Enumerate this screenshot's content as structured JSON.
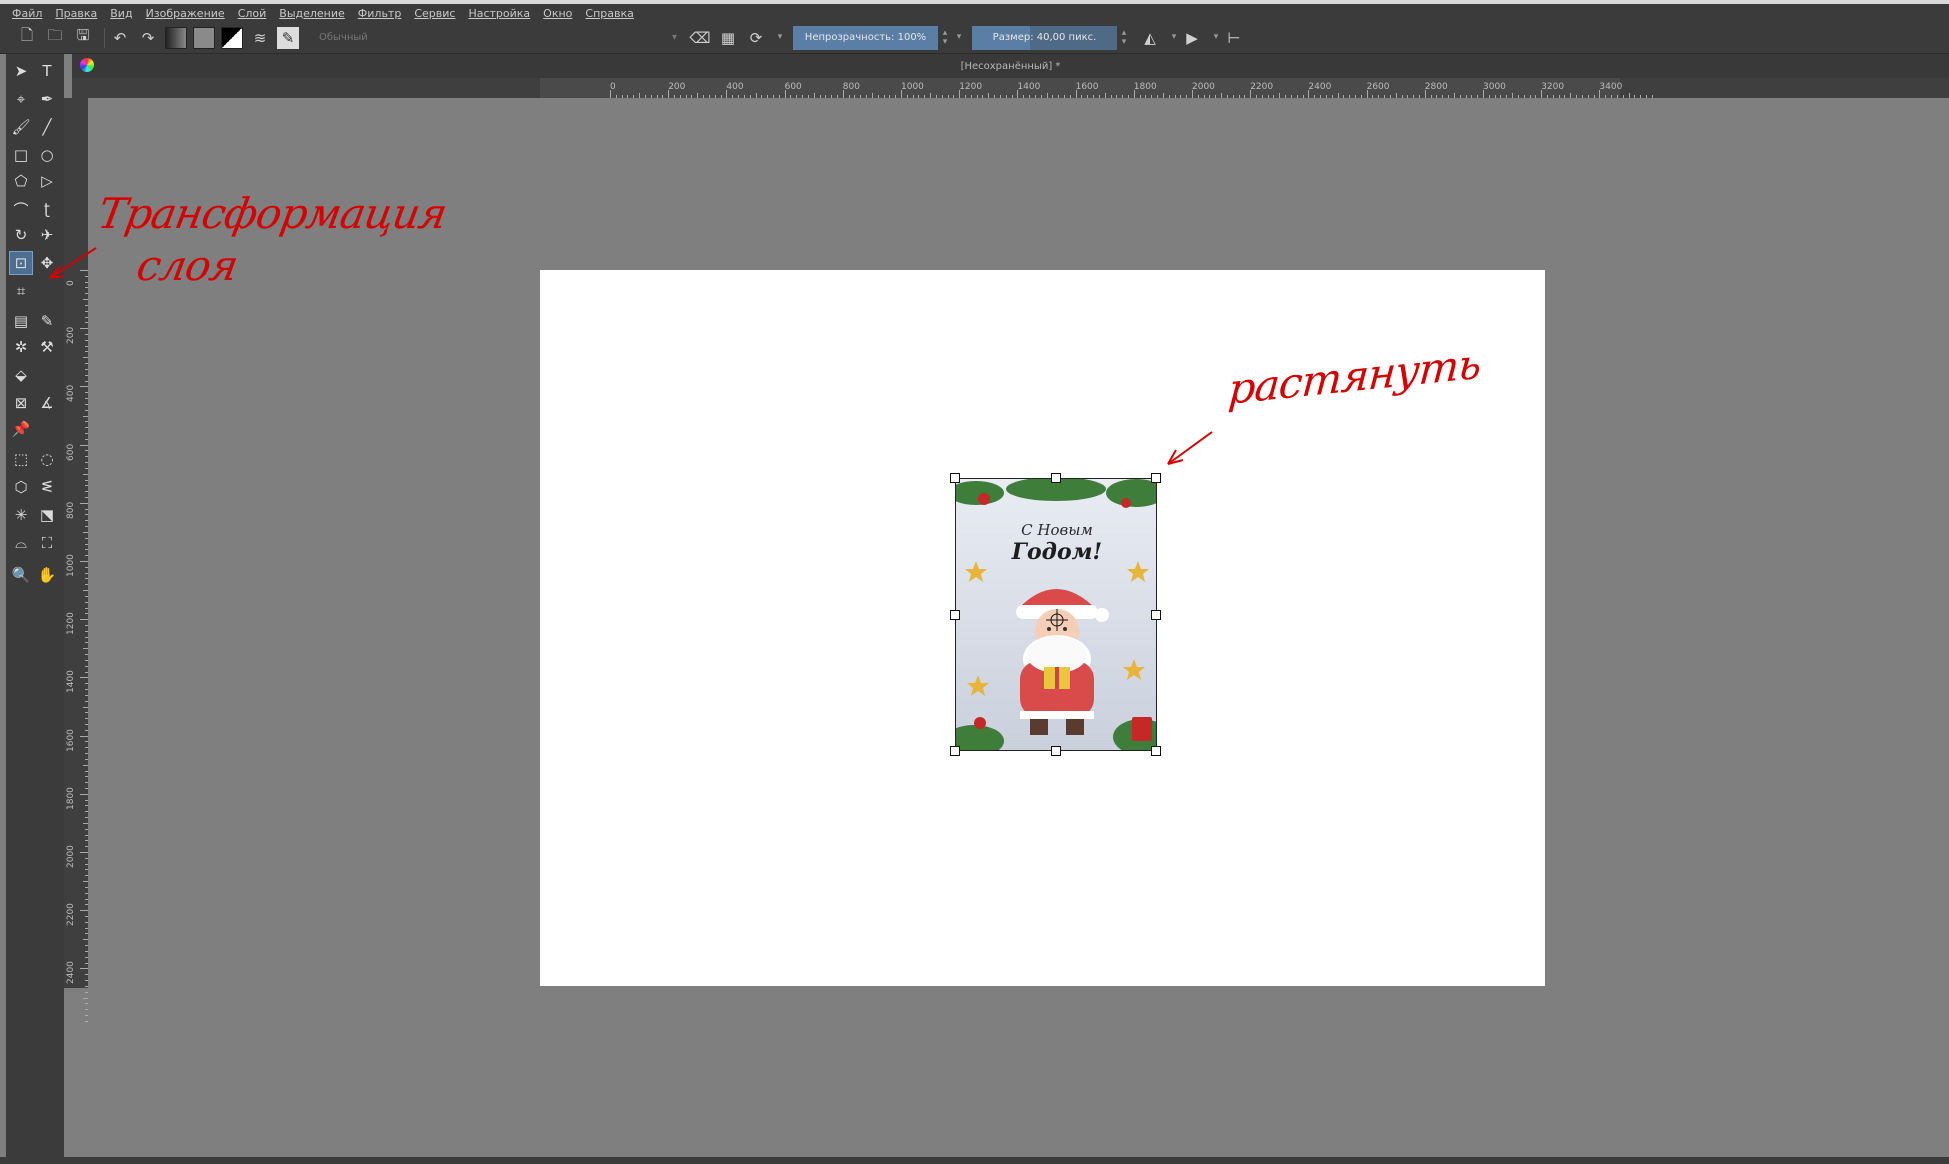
{
  "menu": [
    "Файл",
    "Правка",
    "Вид",
    "Изображение",
    "Слой",
    "Выделение",
    "Фильтр",
    "Сервис",
    "Настройка",
    "Окно",
    "Справка"
  ],
  "toolbar": {
    "preset_label": "Обычный",
    "opacity_label": "Непрозрачность: 100%",
    "opacity_fraction": 1.0,
    "size_label": "Размер: 40,00 пикс.",
    "size_fraction": 0.4
  },
  "document": {
    "title": "[Несохранённый] *"
  },
  "ruler": {
    "horizontal": [
      "0",
      "200",
      "400",
      "600",
      "800",
      "1000",
      "1200",
      "1400",
      "1600",
      "1800",
      "2000",
      "2200",
      "2400",
      "2600",
      "2800",
      "3000",
      "3200",
      "3400"
    ],
    "vertical": [
      "0",
      "200",
      "400",
      "600",
      "800",
      "1000",
      "1200",
      "1400",
      "1600",
      "1800",
      "2000",
      "2200",
      "2400"
    ]
  },
  "layer_card": {
    "line1": "С Новым",
    "line2": "Годом!"
  },
  "annotations": {
    "left_line1": "Трансформация",
    "left_line2": "слоя",
    "right": "растянуть"
  },
  "colors": {
    "accent": "#4c6e93",
    "annotation": "#d50000",
    "canvas_bg": "#7f7f7f",
    "panel": "#3b3b3b"
  },
  "tools": [
    "select-shapes-icon",
    "text-icon",
    "edit-shapes-icon",
    "calligraphy-icon",
    "brush-icon",
    "line-icon",
    "rectangle-icon",
    "ellipse-icon",
    "polygon-icon",
    "polyline-icon",
    "bezier-icon",
    "freehand-path-icon",
    "dynamic-brush-icon",
    "multibrush-icon",
    "transform-icon",
    "move-icon",
    "crop-icon",
    "gradient-icon",
    "color-picker-icon",
    "colorize-mask-icon",
    "smart-patch-icon",
    "fill-icon",
    "assistant-icon",
    "measure-icon",
    "reference-icon",
    "rect-select-icon",
    "ellipse-select-icon",
    "polygon-select-icon",
    "freehand-select-icon",
    "contiguous-select-icon",
    "similar-select-icon",
    "bezier-select-icon",
    "magnetic-select-icon",
    "zoom-icon",
    "pan-icon"
  ]
}
